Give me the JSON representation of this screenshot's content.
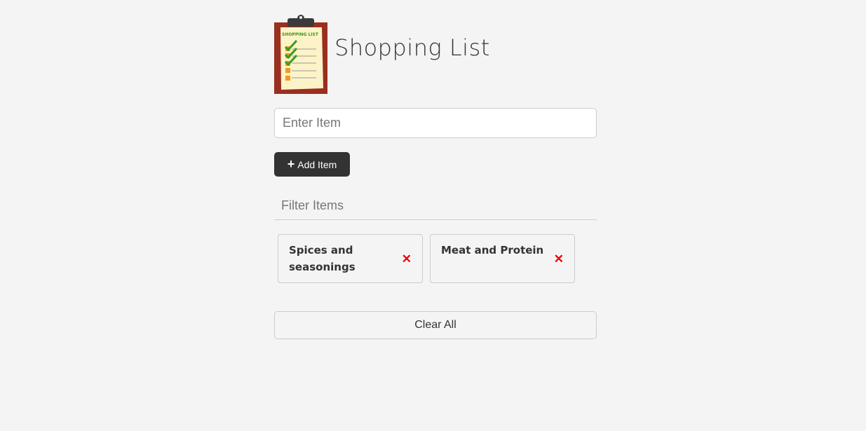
{
  "header": {
    "title": "Shopping List",
    "logo_label": "SHOPPING LIST"
  },
  "form": {
    "item_placeholder": "Enter Item",
    "add_button_label": "Add Item",
    "add_button_icon": "plus-icon"
  },
  "filter": {
    "placeholder": "Filter Items"
  },
  "items": [
    {
      "label": "Spices and seasonings",
      "remove_icon": "close-icon"
    },
    {
      "label": "Meat and Protein",
      "remove_icon": "close-icon"
    }
  ],
  "clear_button_label": "Clear All",
  "colors": {
    "background": "#f4f4f4",
    "button_dark": "#333333",
    "remove_red": "#ee0000",
    "clipboard_board": "#9b2f1f",
    "paper": "#fdf3c8",
    "check_green": "#3a9a1a",
    "box_orange": "#f29a1e"
  }
}
